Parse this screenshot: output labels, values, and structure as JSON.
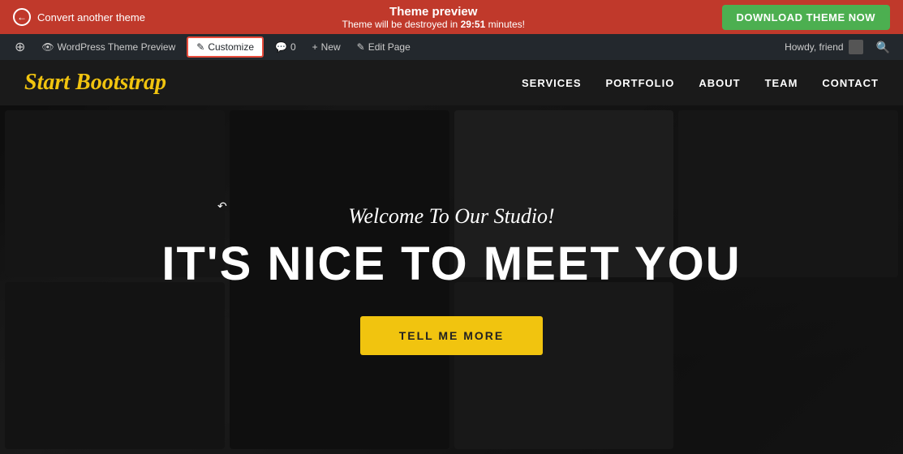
{
  "banner": {
    "convert_label": "Convert another theme",
    "title": "Theme preview",
    "subtitle": "Theme will be destroyed in",
    "countdown": "29:51",
    "countdown_suffix": " minutes!",
    "download_label": "DOWNLOAD THEME NOW"
  },
  "admin_bar": {
    "wp_icon": "W",
    "theme_preview_label": "WordPress Theme Preview",
    "customize_label": "Customize",
    "comments_label": "0",
    "new_label": "New",
    "edit_label": "Edit Page",
    "howdy_label": "Howdy, friend"
  },
  "site": {
    "logo": "Start Bootstrap",
    "nav": [
      {
        "label": "SERVICES"
      },
      {
        "label": "PORTFOLIO"
      },
      {
        "label": "ABOUT"
      },
      {
        "label": "TEAM"
      },
      {
        "label": "CONTACT"
      }
    ]
  },
  "hero": {
    "subtitle": "Welcome To Our Studio!",
    "title": "IT'S NICE TO MEET YOU",
    "cta_label": "TELL ME MORE"
  },
  "colors": {
    "banner_bg": "#c0392b",
    "download_btn": "#4caf50",
    "logo_color": "#f1c40f",
    "cta_bg": "#f1c40f"
  }
}
